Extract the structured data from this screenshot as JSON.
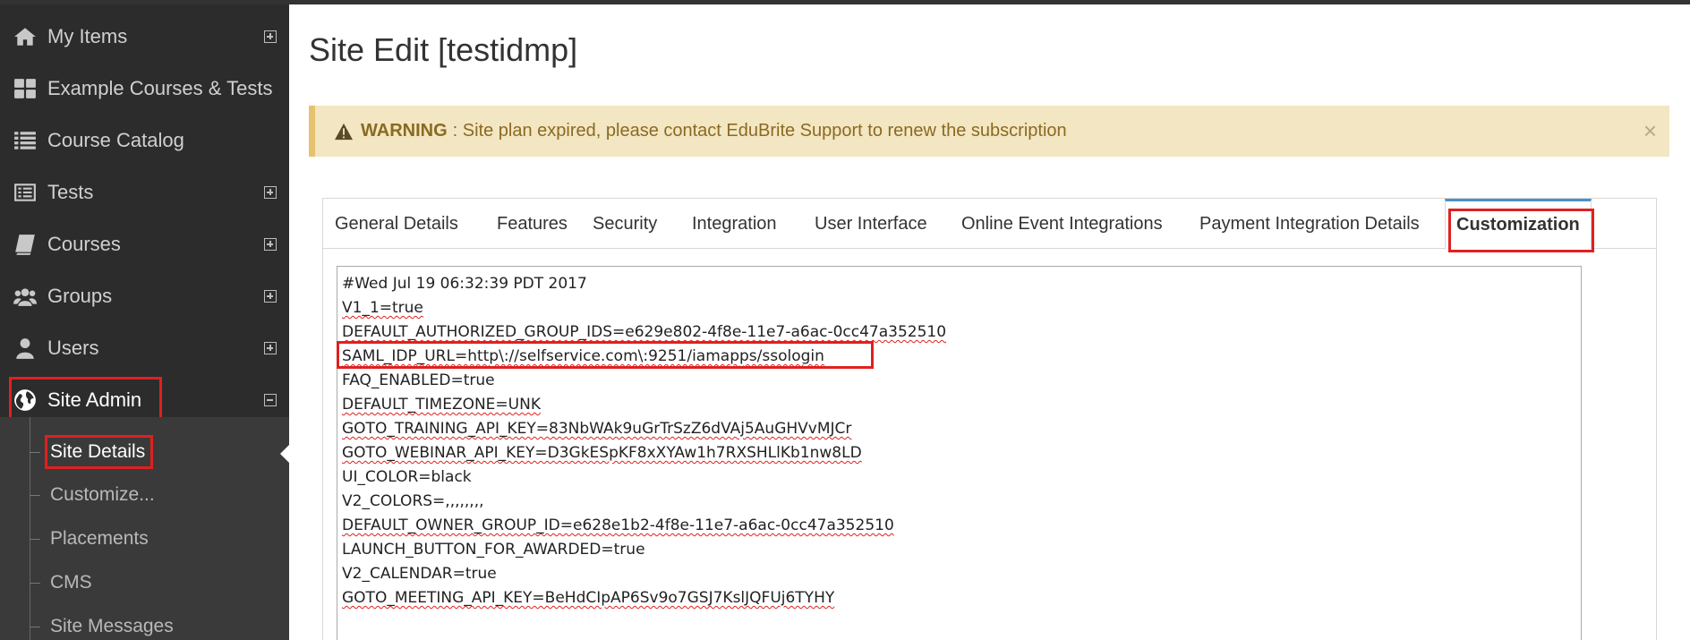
{
  "sidebar": {
    "items": [
      {
        "label": "My Items",
        "icon": "home-icon"
      },
      {
        "label": "Example Courses & Tests",
        "icon": "grid-icon"
      },
      {
        "label": "Course Catalog",
        "icon": "list-icon"
      },
      {
        "label": "Tests",
        "icon": "test-icon"
      },
      {
        "label": "Courses",
        "icon": "book-icon"
      },
      {
        "label": "Groups",
        "icon": "group-icon"
      },
      {
        "label": "Users",
        "icon": "user-icon"
      },
      {
        "label": "Site Admin",
        "icon": "globe-icon"
      }
    ],
    "sub_items": [
      {
        "label": "Site Details"
      },
      {
        "label": "Customize..."
      },
      {
        "label": "Placements"
      },
      {
        "label": "CMS"
      },
      {
        "label": "Site Messages"
      }
    ]
  },
  "main": {
    "title": "Site Edit [testidmp]",
    "alert": {
      "title": "WARNING",
      "text": ": Site plan expired, please contact EduBrite Support to renew the subscription",
      "close": "×",
      "color": "#f3e6c2"
    },
    "tabs": [
      {
        "label": "General Details"
      },
      {
        "label": "Features"
      },
      {
        "label": "Security"
      },
      {
        "label": "Integration"
      },
      {
        "label": "User Interface"
      },
      {
        "label": "Online Event Integrations"
      },
      {
        "label": "Payment Integration Details"
      },
      {
        "label": "Customization"
      }
    ],
    "editor_lines": [
      "#Wed Jul 19 06:32:39 PDT 2017",
      "V1_1=true",
      "DEFAULT_AUTHORIZED_GROUP_IDS=e629e802-4f8e-11e7-a6ac-0cc47a352510",
      "SAML_IDP_URL=http\\://selfservice.com\\:9251/iamapps/ssologin",
      "FAQ_ENABLED=true",
      "DEFAULT_TIMEZONE=UNK",
      "GOTO_TRAINING_API_KEY=83NbWAk9uGrTrSzZ6dVAj5AuGHVvMJCr",
      "GOTO_WEBINAR_API_KEY=D3GkESpKF8xXYAw1h7RXSHLlKb1nw8LD",
      "UI_COLOR=black",
      "V2_COLORS=,,,,,,,,",
      "DEFAULT_OWNER_GROUP_ID=e628e1b2-4f8e-11e7-a6ac-0cc47a352510",
      "LAUNCH_BUTTON_FOR_AWARDED=true",
      "V2_CALENDAR=true",
      "GOTO_MEETING_API_KEY=BeHdCIpAP6Sv9o7GSJ7KslJQFUj6TYHY"
    ]
  },
  "colors": {
    "sidebar_bg": "#2c2c2c",
    "highlight": "#e02020",
    "tab_accent": "#4a90c8"
  }
}
